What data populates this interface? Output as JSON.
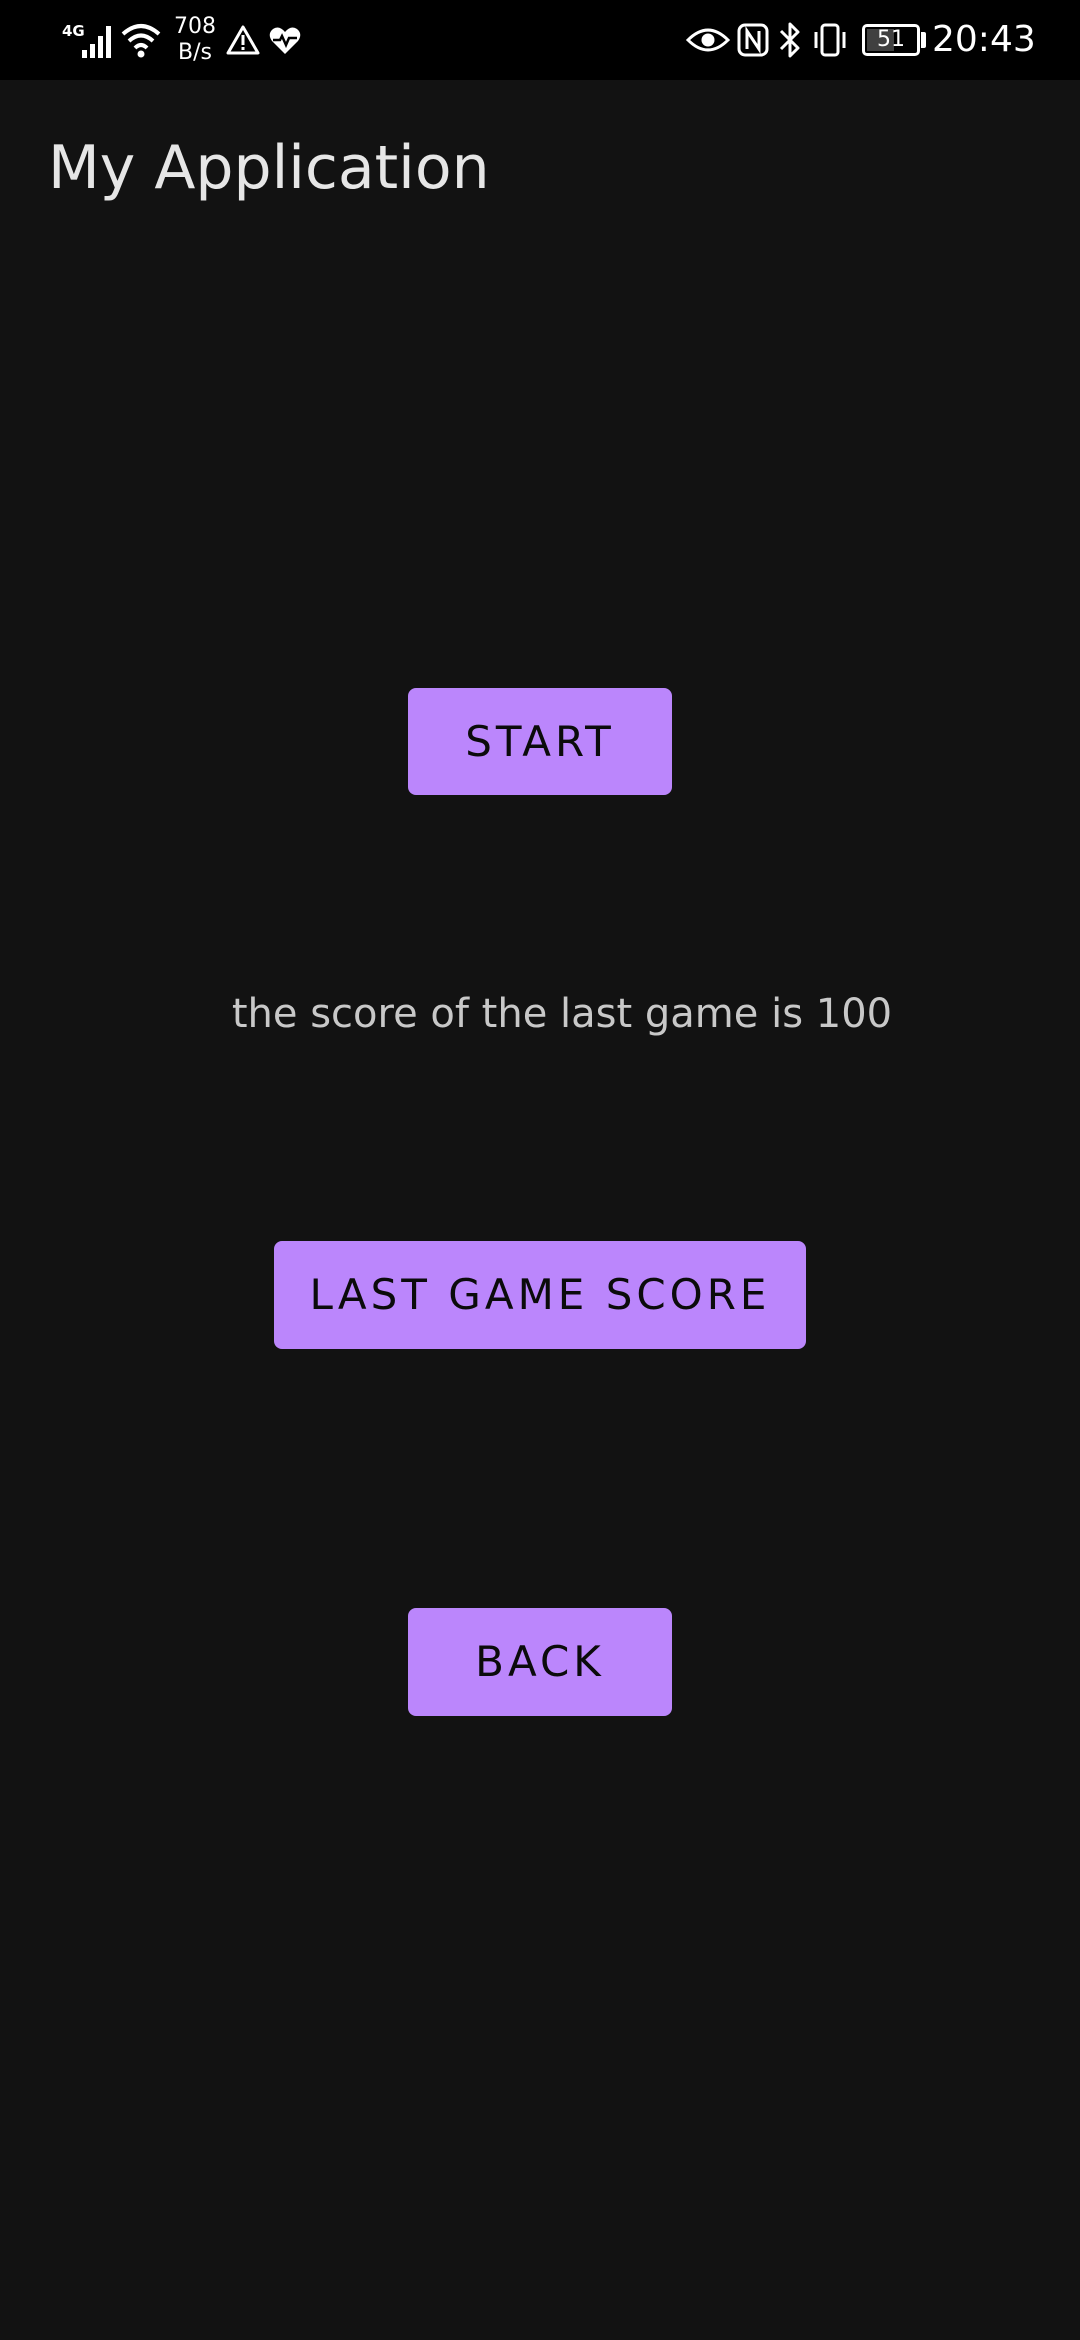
{
  "status_bar": {
    "network_type": "4G",
    "speed_value": "708",
    "speed_unit": "B/s",
    "battery_level": "51",
    "time": "20:43",
    "icons": [
      "signal-icon",
      "wifi-icon",
      "warning-icon",
      "health-icon",
      "eye-icon",
      "nfc-icon",
      "bluetooth-icon",
      "vibrate-icon",
      "battery-icon"
    ]
  },
  "app_bar": {
    "title": "My Application"
  },
  "main": {
    "start_label": "START",
    "score_message": "the score of the last game is 100",
    "last_score_label": "LAST GAME SCORE",
    "back_label": "BACK"
  },
  "colors": {
    "background": "#121212",
    "status_bar": "#000000",
    "accent": "#bb86fc",
    "button_text": "#0b0b0b",
    "title_text": "#e6e6e6",
    "body_text": "#c8c8c8"
  }
}
